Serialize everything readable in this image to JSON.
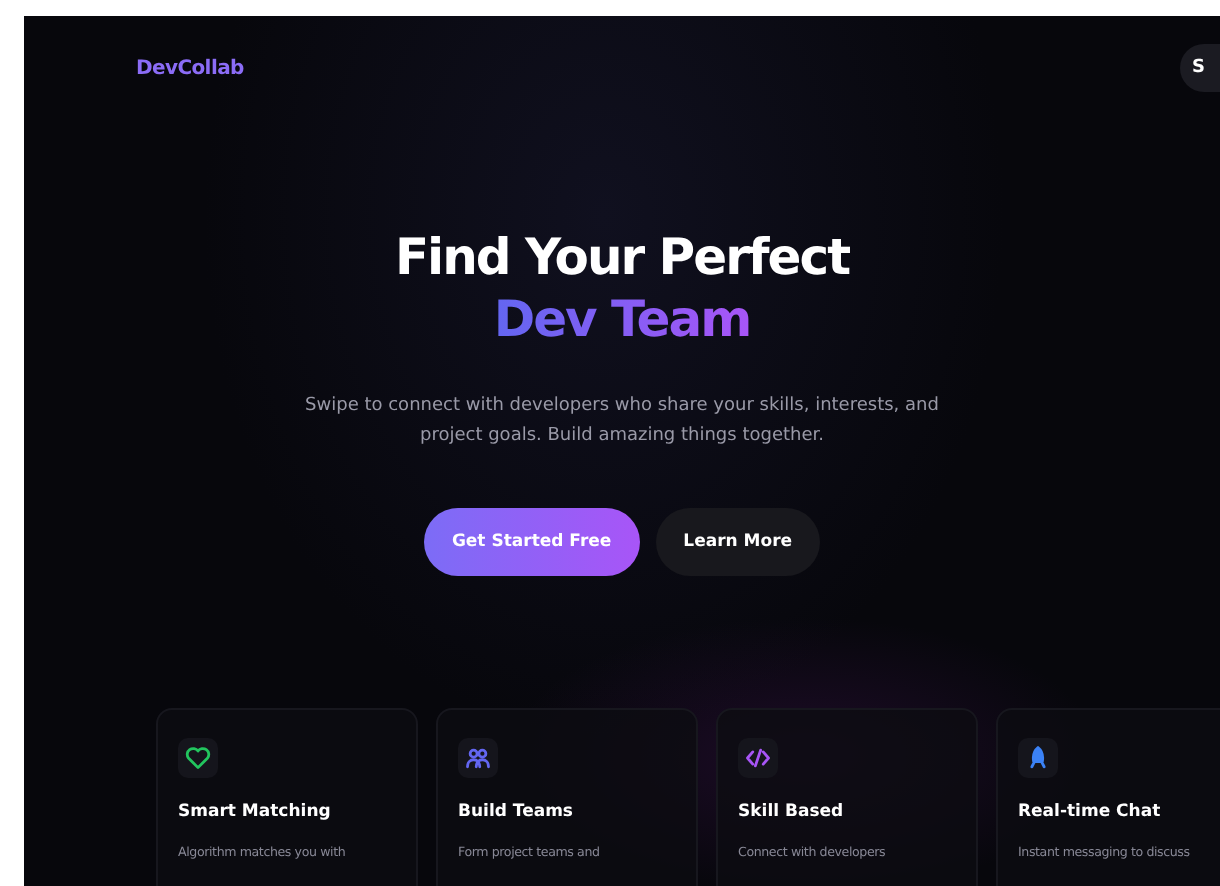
{
  "brand": "DevCollab",
  "nav_button": "S",
  "hero": {
    "title_line_1": "Find Your Perfect",
    "title_line_2": "Dev Team",
    "subtitle": "Swipe to connect with developers who share your skills, interests, and project goals. Build amazing things together.",
    "primary_button": "Get Started Free",
    "secondary_button": "Learn More"
  },
  "features": [
    {
      "kind": "heart",
      "color": "#22c55e",
      "title": "Smart Matching",
      "text": "Algorithm matches you with"
    },
    {
      "kind": "people",
      "color": "#6366f1",
      "title": "Build Teams",
      "text": "Form project teams and"
    },
    {
      "kind": "code",
      "color": "#a855f7",
      "title": "Skill Based",
      "text": "Connect with developers"
    },
    {
      "kind": "rocket",
      "color": "#3b82f6",
      "title": "Real-time Chat",
      "text": "Instant messaging to discuss"
    }
  ]
}
